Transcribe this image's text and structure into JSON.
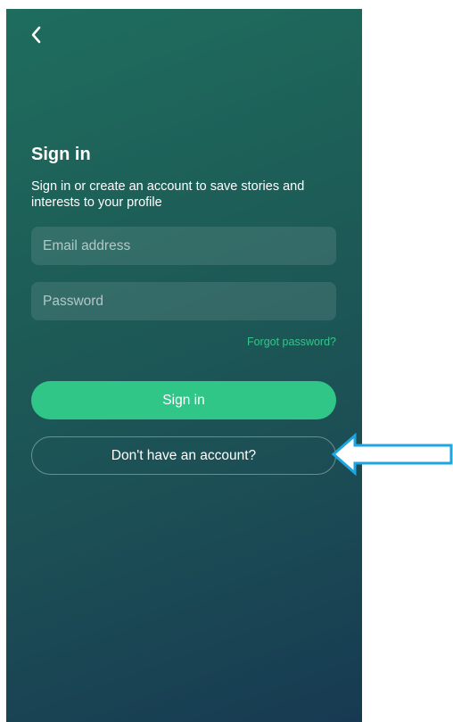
{
  "header": {
    "back_icon": "chevron-left-icon"
  },
  "signin": {
    "title": "Sign in",
    "subtitle": "Sign in or create an account to save stories and interests to your profile",
    "email_placeholder": "Email address",
    "password_placeholder": "Password",
    "forgot_label": "Forgot password?",
    "signin_label": "Sign in",
    "no_account_label": "Don't have an account?"
  },
  "colors": {
    "accent": "#2fc688",
    "link": "#35c58a",
    "annotation_arrow": "#1ea6e0"
  }
}
